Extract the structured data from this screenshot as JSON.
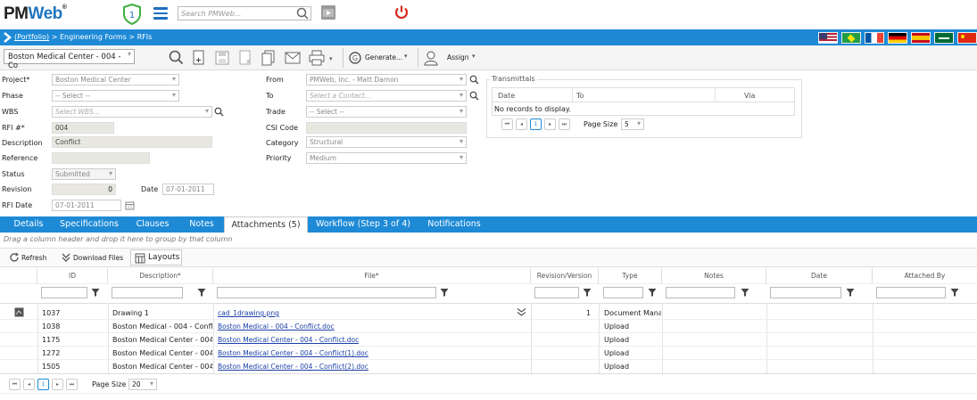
{
  "app": {
    "logo_pm": "PM",
    "logo_web": "Web",
    "shield_count": "1",
    "search_placeholder": "Search PMWeb..."
  },
  "breadcrumb": {
    "portfolio": "(Portfolio)",
    "path": " > Engineering Forms > RFIs"
  },
  "toolbar": {
    "project_select": "Boston Medical Center - 004 - Co",
    "generate_label": "Generate...",
    "assign_label": "Assign"
  },
  "form": {
    "project": {
      "label": "Project*",
      "value": "Boston Medical Center"
    },
    "phase": {
      "label": "Phase",
      "value": "-- Select --"
    },
    "wbs": {
      "label": "WBS",
      "value": "Select WBS..."
    },
    "rfi_no": {
      "label": "RFI #*",
      "value": "004"
    },
    "description": {
      "label": "Description",
      "value": "Conflict"
    },
    "reference": {
      "label": "Reference",
      "value": ""
    },
    "status": {
      "label": "Status",
      "value": "Submitted"
    },
    "revision": {
      "label": "Revision",
      "value": "0"
    },
    "date": {
      "label": "Date",
      "value": "07-01-2011"
    },
    "rfi_date": {
      "label": "RFI Date",
      "value": "07-01-2011"
    },
    "from": {
      "label": "From",
      "value": "PMWeb, Inc. - Matt Damon"
    },
    "to": {
      "label": "To",
      "value": "Select a Contact..."
    },
    "trade": {
      "label": "Trade",
      "value": "-- Select --"
    },
    "csi_code": {
      "label": "CSI Code",
      "value": ""
    },
    "category": {
      "label": "Category",
      "value": "Structural"
    },
    "priority": {
      "label": "Priority",
      "value": "Medium"
    }
  },
  "transmittals": {
    "title": "Transmittals",
    "columns": [
      "Date",
      "To",
      "Via"
    ],
    "empty": "No records to display.",
    "page": "1",
    "page_size_label": "Page Size",
    "page_size": "5"
  },
  "tabs": [
    "Details",
    "Specifications",
    "Clauses",
    "Notes",
    "Attachments (5)",
    "Workflow (Step 3 of 4)",
    "Notifications"
  ],
  "grid": {
    "group_hint": "Drag a column header and drop it here to group by that column",
    "refresh": "Refresh",
    "download": "Download Files",
    "layouts": "Layouts",
    "columns": [
      "ID",
      "Description*",
      "File*",
      "Revision/Version",
      "Type",
      "Notes",
      "Date",
      "Attached By"
    ],
    "rows": [
      {
        "id": "1037",
        "description": "Drawing 1",
        "file": "cad_1drawing.png",
        "revision": "1",
        "type": "Document Manag"
      },
      {
        "id": "1038",
        "description": "Boston Medical - 004 - Conflic",
        "file": "Boston Medical - 004 - Conflict.doc",
        "revision": "",
        "type": "Upload"
      },
      {
        "id": "1175",
        "description": "Boston Medical Center - 004 -",
        "file": "Boston Medical Center - 004 - Conflict.doc",
        "revision": "",
        "type": "Upload"
      },
      {
        "id": "1272",
        "description": "Boston Medical Center - 004 -",
        "file": "Boston Medical Center - 004 - Conflict(1).doc",
        "revision": "",
        "type": "Upload"
      },
      {
        "id": "1505",
        "description": "Boston Medical Center - 004 -",
        "file": "Boston Medical Center - 004 - Conflict(2).doc",
        "revision": "",
        "type": "Upload"
      }
    ],
    "page": "1",
    "page_size_label": "Page Size",
    "page_size": "20"
  }
}
